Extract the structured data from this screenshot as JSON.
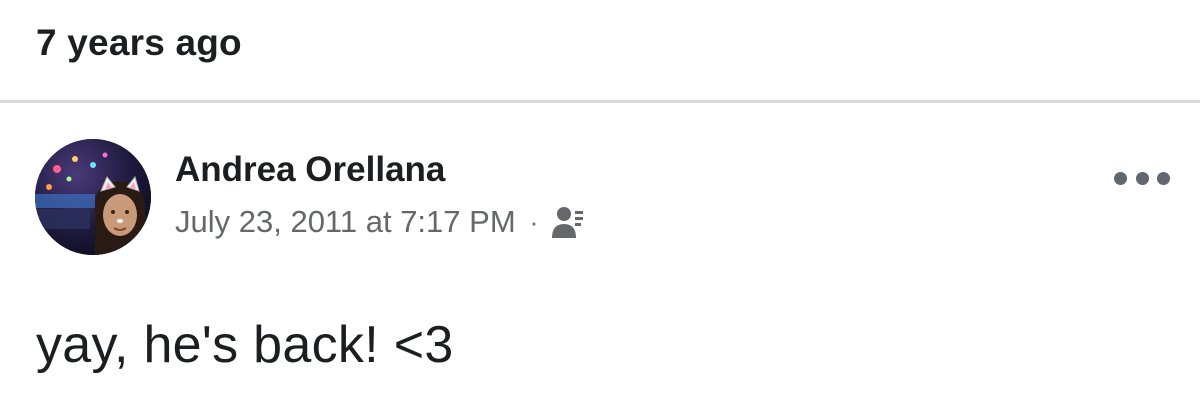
{
  "memory": {
    "title": "7 years ago"
  },
  "post": {
    "author": "Andrea Orellana",
    "timestamp": "July 23, 2011 at 7:17 PM",
    "separator": "·",
    "audience_icon": "friends-icon",
    "text": "yay, he's back! <3",
    "more_icon": "more-options-icon"
  },
  "colors": {
    "text_primary": "#1c1e21",
    "text_secondary": "#65676b",
    "divider": "#d6d7da"
  }
}
